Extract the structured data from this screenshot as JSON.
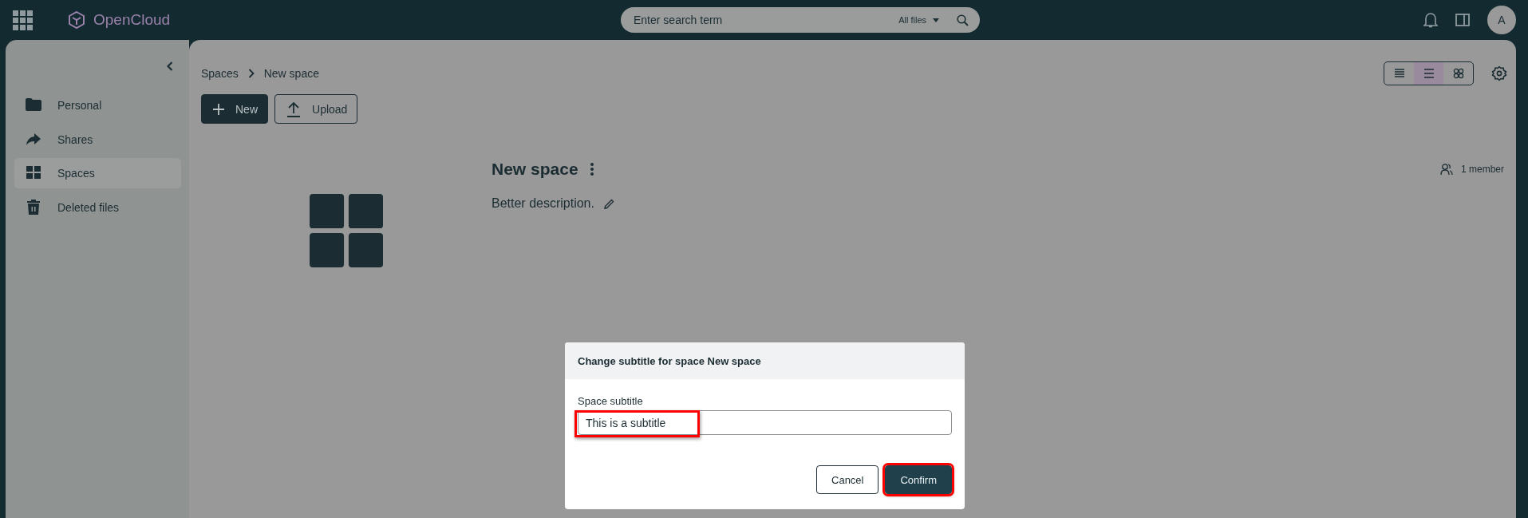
{
  "top_bar": {
    "app_name": "OpenCloud",
    "search": {
      "placeholder": "Enter search term",
      "scope": "All files"
    },
    "avatar": "A"
  },
  "sidebar": {
    "items": [
      {
        "label": "Personal",
        "kind": "personal",
        "selected": false
      },
      {
        "label": "Shares",
        "kind": "shares",
        "selected": false
      },
      {
        "label": "Spaces",
        "kind": "spaces",
        "selected": true
      },
      {
        "label": "Deleted files",
        "kind": "trash",
        "selected": false
      }
    ]
  },
  "breadcrumb": [
    "Spaces",
    "New space"
  ],
  "actions": [
    {
      "label": "New",
      "kind": "primary"
    },
    {
      "label": "Upload",
      "kind": "outline"
    }
  ],
  "view_modes": [
    {
      "kind": "condensed",
      "selected": false
    },
    {
      "kind": "list",
      "selected": true
    },
    {
      "kind": "tiles",
      "selected": false
    }
  ],
  "space": {
    "title": "New space",
    "description": "Better description.",
    "members": "1 member"
  },
  "dialog": {
    "title": "Change subtitle for space New space",
    "field": {
      "label": "Space subtitle",
      "value": "This is a subtitle",
      "highlighted": true
    },
    "buttons": [
      {
        "label": "Cancel",
        "kind": "secondary",
        "highlighted": false
      },
      {
        "label": "Confirm",
        "kind": "primary",
        "highlighted": true
      }
    ]
  }
}
